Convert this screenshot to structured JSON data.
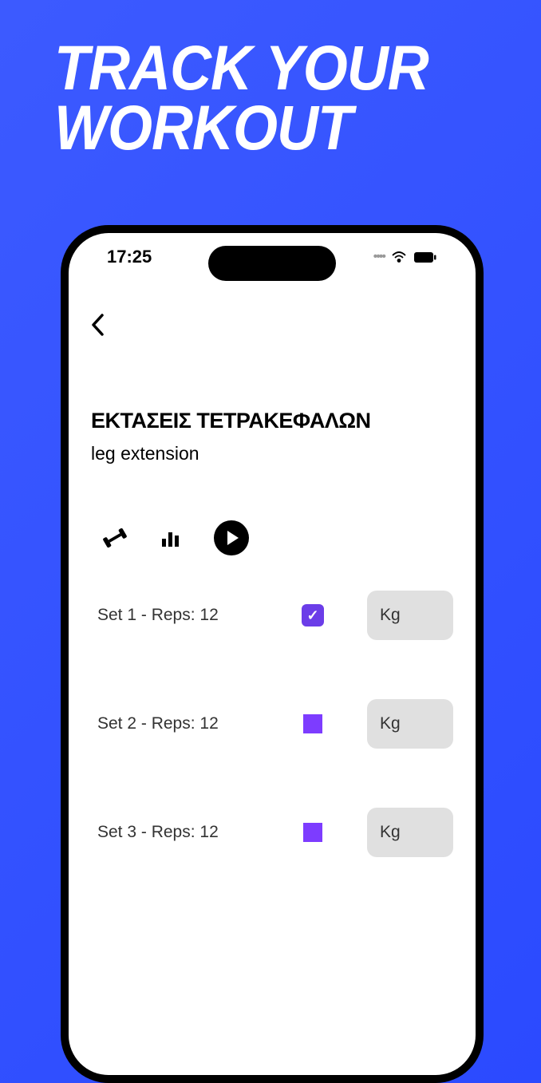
{
  "promo": {
    "title_line1": "TRACK YOUR",
    "title_line2": "WORKOUT"
  },
  "status_bar": {
    "time": "17:25"
  },
  "exercise": {
    "title": "ΕΚΤΑΣΕΙΣ ΤΕΤΡΑΚΕΦΑΛΩΝ",
    "subtitle": "leg extension"
  },
  "sets": [
    {
      "label": "Set 1 - Reps: 12",
      "checked": true,
      "unit": "Kg"
    },
    {
      "label": "Set 2 - Reps: 12",
      "checked": false,
      "unit": "Kg"
    },
    {
      "label": "Set 3 - Reps: 12",
      "checked": false,
      "unit": "Kg"
    }
  ],
  "icons": {
    "dumbbell": "dumbbell-icon",
    "stats": "stats-icon",
    "play": "play-icon"
  }
}
